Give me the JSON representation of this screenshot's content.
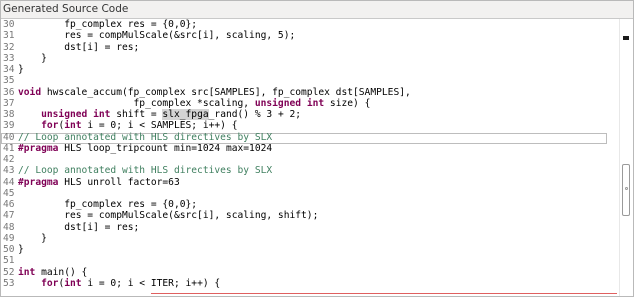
{
  "panel": {
    "title": "Generated Source Code"
  },
  "lines": [
    {
      "num": "30",
      "segments": [
        {
          "t": "        fp_complex res = {0,0};"
        }
      ]
    },
    {
      "num": "31",
      "segments": [
        {
          "t": "        res = compMulScale(&src[i], scaling, 5);"
        }
      ]
    },
    {
      "num": "32",
      "segments": [
        {
          "t": "        dst[i] = res;"
        }
      ]
    },
    {
      "num": "33",
      "segments": [
        {
          "t": "    }"
        }
      ]
    },
    {
      "num": "34",
      "segments": [
        {
          "t": "}"
        }
      ]
    },
    {
      "num": "35",
      "segments": [
        {
          "t": ""
        }
      ]
    },
    {
      "num": "36",
      "segments": [
        {
          "t": "void",
          "c": "kw"
        },
        {
          "t": " hwscale_accum(fp_complex src[SAMPLES], fp_complex dst[SAMPLES],"
        }
      ]
    },
    {
      "num": "37",
      "segments": [
        {
          "t": "                    fp_complex *scaling, "
        },
        {
          "t": "unsigned",
          "c": "kw"
        },
        {
          "t": " "
        },
        {
          "t": "int",
          "c": "kw"
        },
        {
          "t": " size) {"
        }
      ]
    },
    {
      "num": "38",
      "segments": [
        {
          "t": "    "
        },
        {
          "t": "unsigned",
          "c": "kw"
        },
        {
          "t": " "
        },
        {
          "t": "int",
          "c": "kw"
        },
        {
          "t": " shift = "
        },
        {
          "t": "slx_fpga",
          "c": "hl-sel"
        },
        {
          "t": "_rand() % 3 + 2;"
        }
      ]
    },
    {
      "num": "39",
      "segments": [
        {
          "t": "    "
        },
        {
          "t": "for",
          "c": "kw"
        },
        {
          "t": "("
        },
        {
          "t": "int",
          "c": "kw"
        },
        {
          "t": " i = 0; i < SAMPLES; i++) {"
        }
      ]
    },
    {
      "num": "40",
      "segments": [
        {
          "t": "// Loop annotated with HLS directives by SLX",
          "c": "cm"
        }
      ]
    },
    {
      "num": "41",
      "segments": [
        {
          "t": "#pragma",
          "c": "pp"
        },
        {
          "t": " HLS loop_tripcount min=1024 max=1024"
        }
      ]
    },
    {
      "num": "42",
      "segments": [
        {
          "t": ""
        }
      ]
    },
    {
      "num": "43",
      "segments": [
        {
          "t": "// Loop annotated with HLS directives by SLX",
          "c": "cm"
        }
      ]
    },
    {
      "num": "44",
      "segments": [
        {
          "t": "#pragma",
          "c": "pp"
        },
        {
          "t": " HLS unroll factor=63"
        }
      ]
    },
    {
      "num": "45",
      "segments": [
        {
          "t": ""
        }
      ]
    },
    {
      "num": "46",
      "segments": [
        {
          "t": "        fp_complex res = {0,0};"
        }
      ]
    },
    {
      "num": "47",
      "segments": [
        {
          "t": "        res = compMulScale(&src[i], scaling, shift);"
        }
      ]
    },
    {
      "num": "48",
      "segments": [
        {
          "t": "        dst[i] = res;"
        }
      ]
    },
    {
      "num": "49",
      "segments": [
        {
          "t": "    }"
        }
      ]
    },
    {
      "num": "50",
      "segments": [
        {
          "t": "}"
        }
      ]
    },
    {
      "num": "51",
      "segments": [
        {
          "t": ""
        }
      ]
    },
    {
      "num": "52",
      "segments": [
        {
          "t": "int",
          "c": "kw"
        },
        {
          "t": " main() {"
        }
      ]
    },
    {
      "num": "53",
      "segments": [
        {
          "t": "    "
        },
        {
          "t": "for",
          "c": "kw"
        },
        {
          "t": "("
        },
        {
          "t": "int",
          "c": "kw"
        },
        {
          "t": " i = 0; i < ITER; i++) {"
        }
      ]
    }
  ],
  "colors": {
    "keyword": "#7f0055",
    "comment": "#3f7f5f",
    "line_number": "#787878"
  },
  "icons": {
    "overview_marker": "overview-marker-icon",
    "scroll_grip": "scroll-grip-icon"
  }
}
